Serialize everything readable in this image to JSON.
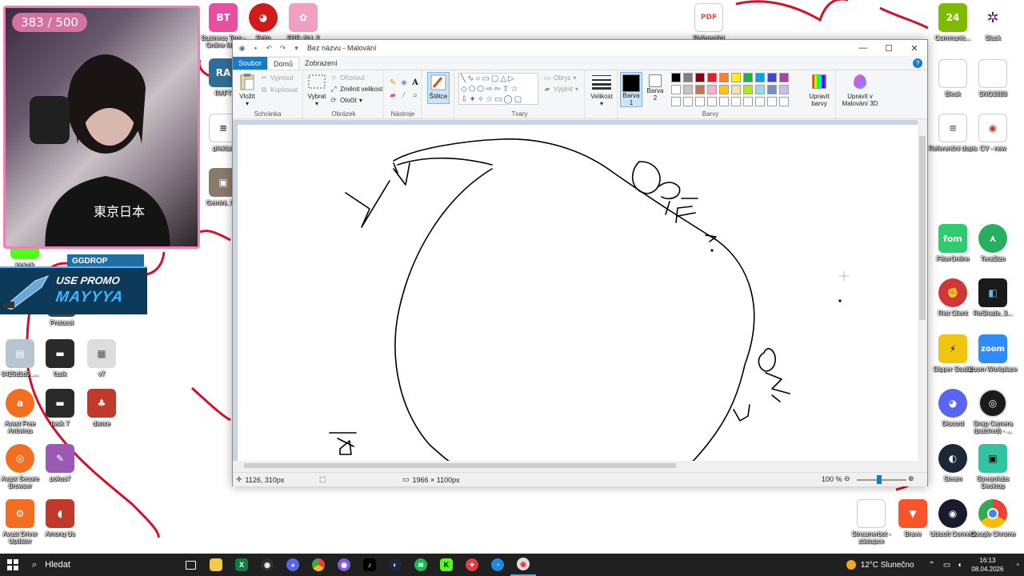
{
  "overlay": {
    "counter": "383 / 500",
    "promo": {
      "tag": "GGDROP",
      "line1": "USE PROMO",
      "line2": "MAYYYA"
    }
  },
  "desktop_icons": [
    {
      "label": "Business Tour - Online Mu...",
      "color": "#e84fa0"
    },
    {
      "label": "Feim",
      "color": "#d11a1a"
    },
    {
      "label": "FNF: ALL 2",
      "color": "#f0a0c0"
    },
    {
      "label": "RAFT",
      "color": "#2d6e98"
    },
    {
      "label": "překlad",
      "color": "#ffffff"
    },
    {
      "label": "Gemini_G...",
      "color": "#8a7a6a"
    },
    {
      "label": "kickzik",
      "color": "#53fc18"
    },
    {
      "label": "Protocol",
      "color": "#444444"
    },
    {
      "label": "6425d1d9_...",
      "color": "#b8c4d0"
    },
    {
      "label": "fasik",
      "color": "#2a2a2a"
    },
    {
      "label": "v7",
      "color": "#dddddd"
    },
    {
      "label": "Avast Free Antivirus",
      "color": "#f26f21"
    },
    {
      "label": "fasik 7",
      "color": "#2a2a2a"
    },
    {
      "label": "dance",
      "color": "#c0392b"
    },
    {
      "label": "Avast Secure Browser",
      "color": "#f26f21"
    },
    {
      "label": "pokus7",
      "color": "#9b59b6"
    },
    {
      "label": "Avast Driver Updater",
      "color": "#f26f21"
    },
    {
      "label": "Among Us",
      "color": "#c0392b"
    },
    {
      "label": "Referenční",
      "color": "#e74c3c"
    },
    {
      "label": "Communic...",
      "color": "#7fba00"
    },
    {
      "label": "Slack",
      "color": "#611f69"
    },
    {
      "label": "Blesk",
      "color": "#ffffff"
    },
    {
      "label": "SNG3888",
      "color": "#ffffff"
    },
    {
      "label": "Referenční dopis",
      "color": "#ffffff"
    },
    {
      "label": "CV - new",
      "color": "#ffffff"
    },
    {
      "label": "FilterOnline",
      "color": "#2ecc71"
    },
    {
      "label": "TeraSize",
      "color": "#27ae60"
    },
    {
      "label": "Riot Client",
      "color": "#d13639"
    },
    {
      "label": "ReShade_3...",
      "color": "#1a1a1a"
    },
    {
      "label": "Dipper Studio",
      "color": "#f1c40f"
    },
    {
      "label": "Zoom Workplace",
      "color": "#2d8cff"
    },
    {
      "label": "Discord",
      "color": "#5865f2"
    },
    {
      "label": "Snap Camera (patched) - ...",
      "color": "#1a1a1a"
    },
    {
      "label": "Steam",
      "color": "#1b2838"
    },
    {
      "label": "Streamlabs Desktop",
      "color": "#31c3a2"
    },
    {
      "label": "Streamerbot - zástupce",
      "color": "#ffffff"
    },
    {
      "label": "Brave",
      "color": "#fb542b"
    },
    {
      "label": "Ubisoft Connect",
      "color": "#1a1a2e"
    },
    {
      "label": "Google Chrome",
      "color": "#4285f4"
    }
  ],
  "paint": {
    "title": "Bez názvu - Malování",
    "tabs": [
      "Soubor",
      "Domů",
      "Zobrazení"
    ],
    "clipboard": {
      "paste": "Vložit",
      "cut": "Vyjmout",
      "copy": "Kopírovat",
      "label": "Schránka"
    },
    "image": {
      "select": "Vybrat",
      "crop": "Oříznout",
      "resize": "Změnit velikost",
      "rotate": "Otočit",
      "label": "Obrázek"
    },
    "tools": {
      "label": "Nástroje",
      "brushes": "Štětce"
    },
    "shapes": {
      "outline": "Obrys",
      "fill": "Výplnit",
      "label": "Tvary"
    },
    "size": "Velikost",
    "color1": "Barva 1",
    "color2": "Barva 2",
    "colors_label": "Barvy",
    "edit_colors": "Upravit barvy",
    "paint3d": "Upravit v Malování 3D",
    "palette": [
      "#000000",
      "#7f7f7f",
      "#880015",
      "#ed1c24",
      "#ff7f27",
      "#fff200",
      "#22b14c",
      "#00a2e8",
      "#3f48cc",
      "#a349a4",
      "#ffffff",
      "#c3c3c3",
      "#b97a57",
      "#ffaec9",
      "#ffc90e",
      "#efe4b0",
      "#b5e61d",
      "#99d9ea",
      "#7092be",
      "#c8bfe7"
    ],
    "status": {
      "cursor": "1126, 310px",
      "size": "1966 × 1100px",
      "zoom": "100 %"
    }
  },
  "taskbar": {
    "search": "Hledat",
    "weather": "12°C  Slunečno",
    "time": "16:13",
    "date": "08.04.2026"
  }
}
